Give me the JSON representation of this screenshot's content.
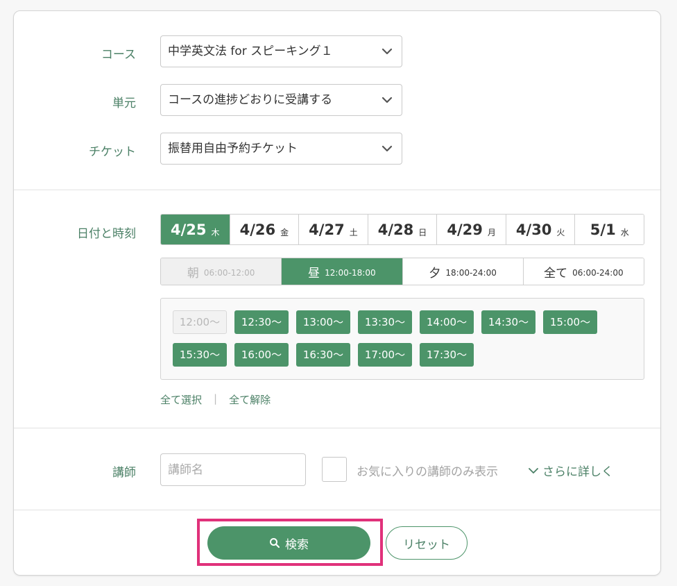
{
  "course": {
    "label": "コース",
    "value": "中学英文法 for スピーキング１"
  },
  "unit": {
    "label": "単元",
    "value": "コースの進捗どおりに受講する"
  },
  "ticket": {
    "label": "チケット",
    "value": "振替用自由予約チケット"
  },
  "datetime": {
    "label": "日付と時刻",
    "dates": [
      {
        "date": "4/25",
        "weekday": "木",
        "selected": true
      },
      {
        "date": "4/26",
        "weekday": "金"
      },
      {
        "date": "4/27",
        "weekday": "土"
      },
      {
        "date": "4/28",
        "weekday": "日"
      },
      {
        "date": "4/29",
        "weekday": "月"
      },
      {
        "date": "4/30",
        "weekday": "火"
      },
      {
        "date": "5/1",
        "weekday": "水"
      }
    ],
    "periods": [
      {
        "name": "朝",
        "range": "06:00-12:00",
        "state": "disabled"
      },
      {
        "name": "昼",
        "range": "12:00-18:00",
        "state": "selected"
      },
      {
        "name": "夕",
        "range": "18:00-24:00",
        "state": "normal"
      },
      {
        "name": "全て",
        "range": "06:00-24:00",
        "state": "normal"
      }
    ],
    "slots": [
      {
        "time": "12:00〜",
        "state": "disabled"
      },
      {
        "time": "12:30〜",
        "state": "selected"
      },
      {
        "time": "13:00〜",
        "state": "selected"
      },
      {
        "time": "13:30〜",
        "state": "selected"
      },
      {
        "time": "14:00〜",
        "state": "selected"
      },
      {
        "time": "14:30〜",
        "state": "selected"
      },
      {
        "time": "15:00〜",
        "state": "selected"
      },
      {
        "time": "15:30〜",
        "state": "selected"
      },
      {
        "time": "16:00〜",
        "state": "selected"
      },
      {
        "time": "16:30〜",
        "state": "selected"
      },
      {
        "time": "17:00〜",
        "state": "selected"
      },
      {
        "time": "17:30〜",
        "state": "selected"
      }
    ],
    "select_all": "全て選択",
    "deselect_all": "全て解除"
  },
  "teacher": {
    "label": "講師",
    "placeholder": "講師名",
    "favorites_only": "お気に入りの講師のみ表示",
    "more": "さらに詳しく"
  },
  "actions": {
    "search": "検索",
    "reset": "リセット"
  },
  "colors": {
    "accent": "#4c9469",
    "label": "#4b8066",
    "highlight": "#e0317a"
  }
}
